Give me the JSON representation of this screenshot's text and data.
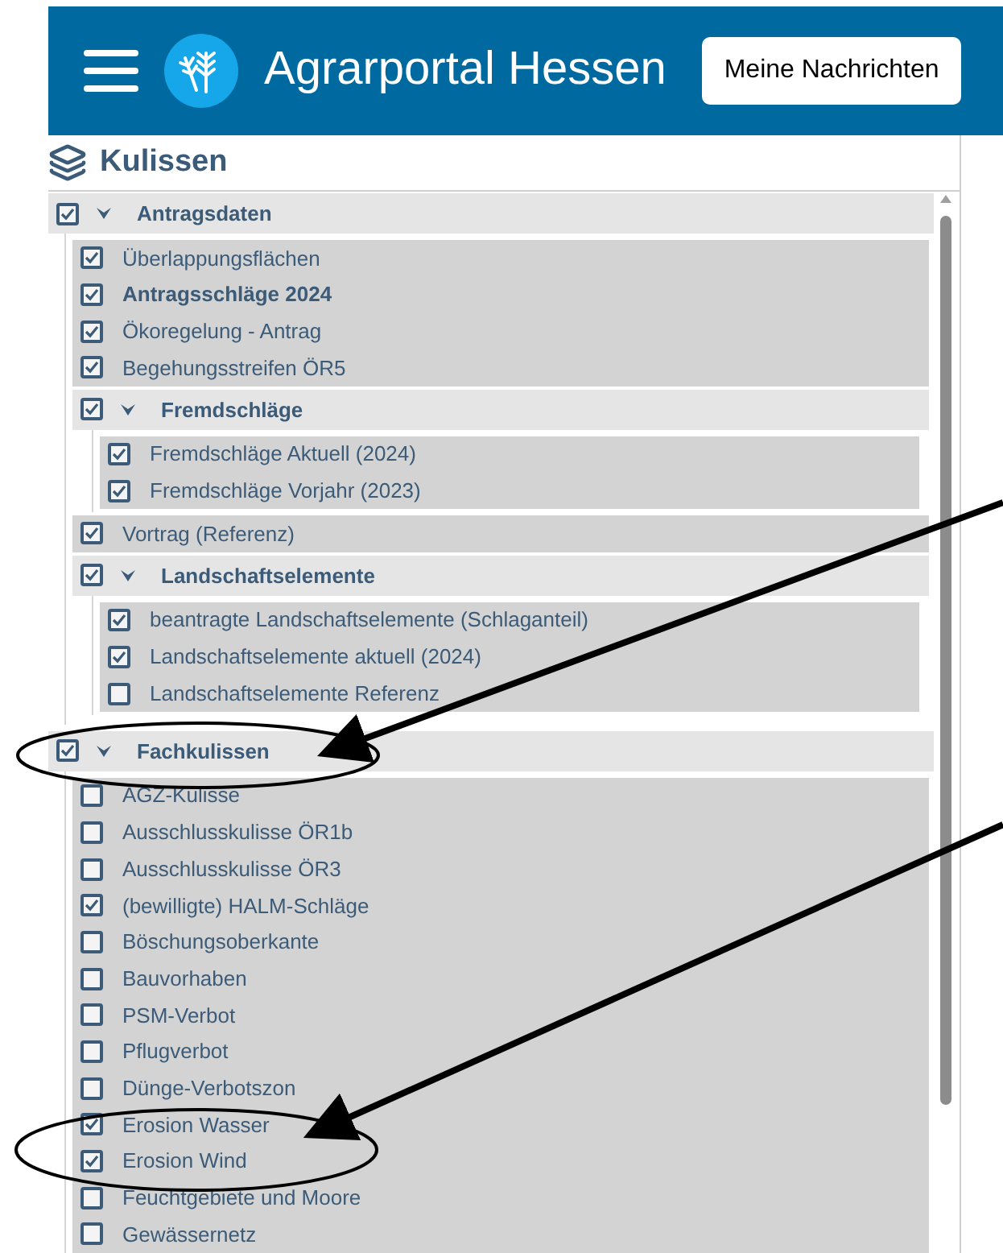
{
  "header": {
    "title": "Agrarportal Hessen",
    "messages_button": "Meine Nachrichten"
  },
  "panel": {
    "title": "Kulissen"
  },
  "tree": [
    {
      "kind": "group",
      "label": "Antragsdaten",
      "checked": true,
      "expanded": true,
      "children": [
        {
          "kind": "item",
          "label": "Überlappungsflächen",
          "checked": true
        },
        {
          "kind": "item",
          "label": "Antragsschläge 2024",
          "checked": true,
          "bold": true
        },
        {
          "kind": "item",
          "label": "Ökoregelung - Antrag",
          "checked": true
        },
        {
          "kind": "item",
          "label": "Begehungsstreifen ÖR5",
          "checked": true
        },
        {
          "kind": "group",
          "label": "Fremdschläge",
          "checked": true,
          "expanded": true,
          "children": [
            {
              "kind": "item",
              "label": "Fremdschläge Aktuell (2024)",
              "checked": true
            },
            {
              "kind": "item",
              "label": "Fremdschläge Vorjahr (2023)",
              "checked": true
            }
          ]
        },
        {
          "kind": "item",
          "label": "Vortrag (Referenz)",
          "checked": true
        },
        {
          "kind": "group",
          "label": "Landschaftselemente",
          "checked": true,
          "expanded": true,
          "children": [
            {
              "kind": "item",
              "label": "beantragte Landschaftselemente (Schlaganteil)",
              "checked": true
            },
            {
              "kind": "item",
              "label": "Landschaftselemente aktuell (2024)",
              "checked": true
            },
            {
              "kind": "item",
              "label": "Landschaftselemente Referenz",
              "checked": false
            }
          ]
        }
      ]
    },
    {
      "kind": "group",
      "label": "Fachkulissen",
      "checked": true,
      "expanded": true,
      "children": [
        {
          "kind": "item",
          "label": "AGZ-Kulisse",
          "checked": false
        },
        {
          "kind": "item",
          "label": "Ausschlusskulisse ÖR1b",
          "checked": false
        },
        {
          "kind": "item",
          "label": "Ausschlusskulisse ÖR3",
          "checked": false
        },
        {
          "kind": "item",
          "label": "(bewilligte) HALM-Schläge",
          "checked": true
        },
        {
          "kind": "item",
          "label": "Böschungsoberkante",
          "checked": false
        },
        {
          "kind": "item",
          "label": "Bauvorhaben",
          "checked": false
        },
        {
          "kind": "item",
          "label": "PSM-Verbot",
          "checked": false
        },
        {
          "kind": "item",
          "label": "Pflugverbot",
          "checked": false
        },
        {
          "kind": "item",
          "label": "Dünge-Verbotszon",
          "checked": false
        },
        {
          "kind": "item",
          "label": "Erosion Wasser",
          "checked": true
        },
        {
          "kind": "item",
          "label": "Erosion Wind",
          "checked": true
        },
        {
          "kind": "item",
          "label": "Feuchtgebiete und Moore",
          "checked": false
        },
        {
          "kind": "item",
          "label": "Gewässernetz",
          "checked": false
        }
      ]
    }
  ]
}
